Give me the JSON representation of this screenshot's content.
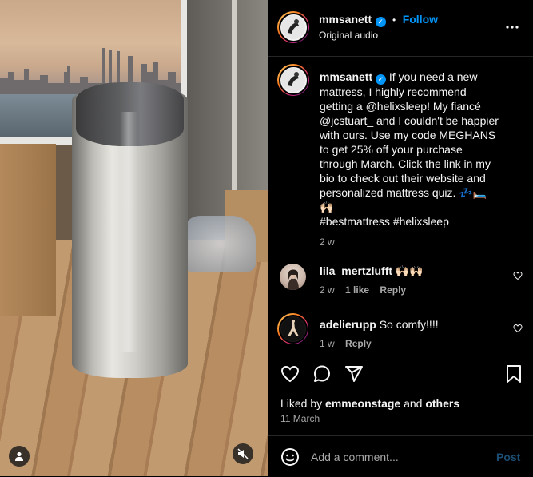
{
  "header": {
    "username": "mmsanett",
    "separator": "•",
    "follow_label": "Follow",
    "audio_label": "Original audio"
  },
  "post": {
    "username": "mmsanett",
    "caption_lines": [
      "If you need a new",
      "mattress, I highly recommend",
      "getting a @helixsleep! My fiancé",
      "@jcstuart_ and I couldn't be happier",
      "with ours. Use my code MEGHANS",
      "to get 25% off your purchase",
      "through March. Click the link in my",
      "bio to check out their website and",
      "personalized mattress quiz. 💤🛏️",
      "🙌🏻",
      "#bestmattress #helixsleep"
    ],
    "time_ago": "2 w"
  },
  "comments": [
    {
      "username": "lila_mertzlufft",
      "text": "🙌🏻🙌🏻",
      "time": "2 w",
      "likes": "1 like",
      "reply_label": "Reply"
    },
    {
      "username": "adelierupp",
      "text": "So comfy!!!!",
      "time": "1 w",
      "reply_label": "Reply"
    }
  ],
  "liked_by": {
    "prefix": "Liked by ",
    "user": "emmeonstage",
    "and": " and ",
    "others": "others"
  },
  "date": "11 March",
  "add_comment": {
    "placeholder": "Add a comment...",
    "post_label": "Post"
  },
  "icons": {
    "more": "more-horizontal-icon",
    "like": "heart-icon",
    "comment": "comment-bubble-icon",
    "share": "paper-plane-icon",
    "save": "bookmark-icon",
    "emoji": "smiley-icon",
    "mute": "speaker-muted-icon",
    "tagged": "person-icon"
  },
  "colors": {
    "accent": "#0095f6",
    "background": "#000000",
    "divider": "#262626",
    "muted_text": "#a8a8a8"
  }
}
